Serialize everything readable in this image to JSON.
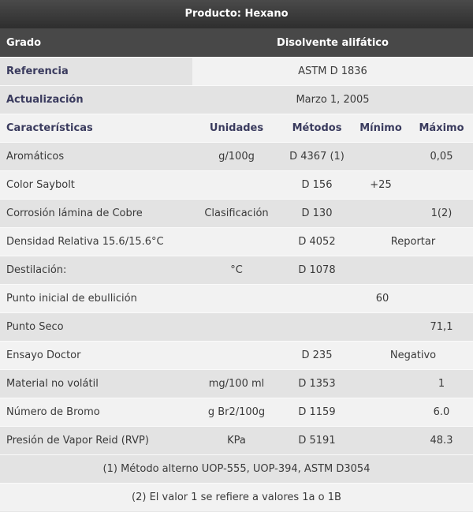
{
  "title": "Producto: Hexano",
  "grade": {
    "label": "Grado",
    "value": "Disolvente alifático"
  },
  "referencia": {
    "label": "Referencia",
    "value": "ASTM D 1836"
  },
  "actualizacion": {
    "label": "Actualización",
    "value": "Marzo 1, 2005"
  },
  "headers": {
    "caracteristicas": "Características",
    "unidades": "Unidades",
    "metodos": "Métodos",
    "minimo": "Mínimo",
    "maximo": "Máximo"
  },
  "rows": [
    {
      "name": "Aromáticos",
      "unidades": "g/100g",
      "metodo": "D 4367 (1)",
      "minimo": "",
      "maximo": "0,05"
    },
    {
      "name": "Color Saybolt",
      "unidades": "",
      "metodo": "D 156",
      "minimo": "+25",
      "maximo": ""
    },
    {
      "name": "Corrosión lámina de Cobre",
      "unidades": "Clasificación",
      "metodo": "D 130",
      "minimo": "",
      "maximo": "1(2)"
    },
    {
      "name": "Densidad Relativa 15.6/15.6°C",
      "unidades": "",
      "metodo": "D 4052",
      "minimo": "Reportar",
      "maximo": ""
    },
    {
      "name": "Destilación:",
      "unidades": "°C",
      "metodo": "D 1078",
      "minimo": "",
      "maximo": ""
    },
    {
      "name": "Punto inicial de ebullición",
      "unidades": "",
      "metodo": "",
      "minimo": "60",
      "maximo": ""
    },
    {
      "name": "Punto Seco",
      "unidades": "",
      "metodo": "",
      "minimo": "",
      "maximo": "71,1"
    },
    {
      "name": "Ensayo Doctor",
      "unidades": "",
      "metodo": "D 235",
      "minimo": "Negativo",
      "maximo": ""
    },
    {
      "name": "Material no volátil",
      "unidades": "mg/100 ml",
      "metodo": "D 1353",
      "minimo": "",
      "maximo": "1"
    },
    {
      "name": "Número de Bromo",
      "unidades": "g Br2/100g",
      "metodo": "D 1159",
      "minimo": "",
      "maximo": "6.0"
    },
    {
      "name": "Presión de Vapor Reid (RVP)",
      "unidades": "KPa",
      "metodo": "D 5191",
      "minimo": "",
      "maximo": "48.3"
    }
  ],
  "notes": [
    "(1) Método alterno UOP-555, UOP-394, ASTM D3054",
    "(2) El valor 1 se refiere a valores 1a o 1B"
  ]
}
